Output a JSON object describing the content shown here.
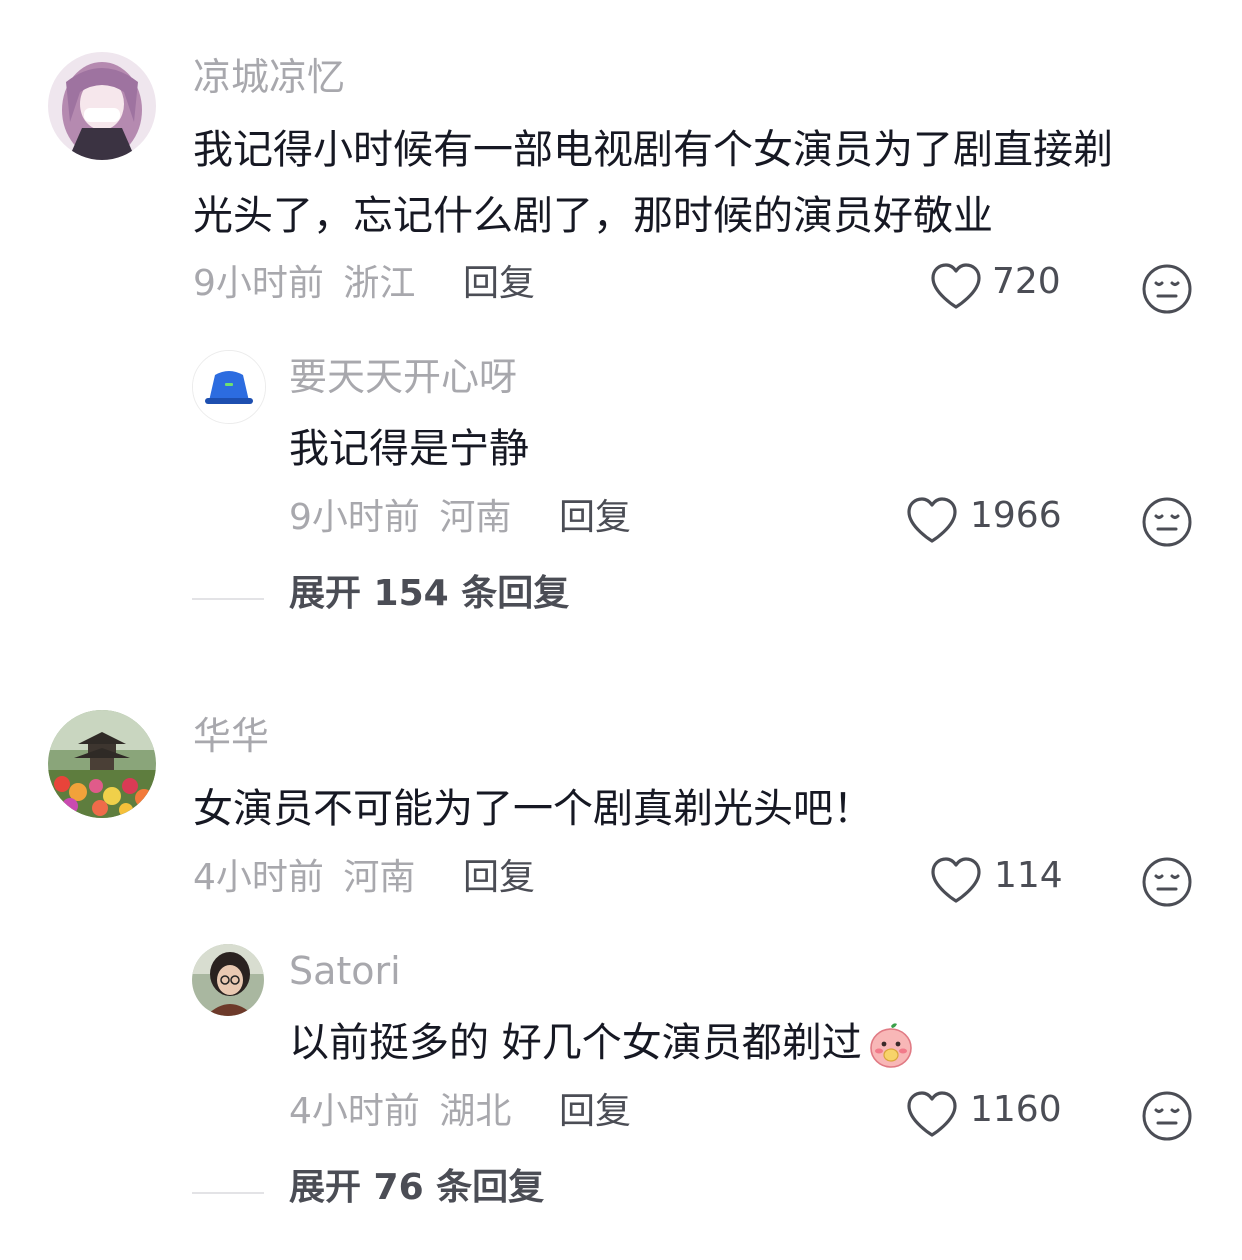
{
  "comments": [
    {
      "username": "凉城凉忆",
      "text_line1": "我记得小时候有一部电视剧有个女演员为了剧直接剃",
      "text_line2": "光头了，忘记什么剧了，那时候的演员好敬业",
      "time": "9小时前",
      "location": "浙江",
      "reply_label": "回复",
      "likes": "720",
      "avatar_icon": "anime-girl-avatar",
      "reply": {
        "username": "要天天开心呀",
        "text": "我记得是宁静",
        "time": "9小时前",
        "location": "河南",
        "reply_label": "回复",
        "likes": "1966",
        "avatar_icon": "blue-bucket-hat-avatar"
      },
      "expand_label": "展开 154 条回复"
    },
    {
      "username": "华华",
      "text_line1": "女演员不可能为了一个剧真剃光头吧！",
      "time": "4小时前",
      "location": "河南",
      "reply_label": "回复",
      "likes": "114",
      "avatar_icon": "pagoda-flowers-avatar",
      "reply": {
        "username": "Satori",
        "text": "以前挺多的 好几个女演员都剃过",
        "time": "4小时前",
        "location": "湖北",
        "reply_label": "回复",
        "likes": "1160",
        "avatar_icon": "girl-with-glasses-avatar",
        "emoji_icon": "peach-blush-emoji"
      },
      "expand_label": "展开 76 条回复"
    }
  ],
  "colors": {
    "username": "#a8a8ad",
    "text": "#161823",
    "meta": "#a8a8ad",
    "action": "#4b4d55"
  }
}
